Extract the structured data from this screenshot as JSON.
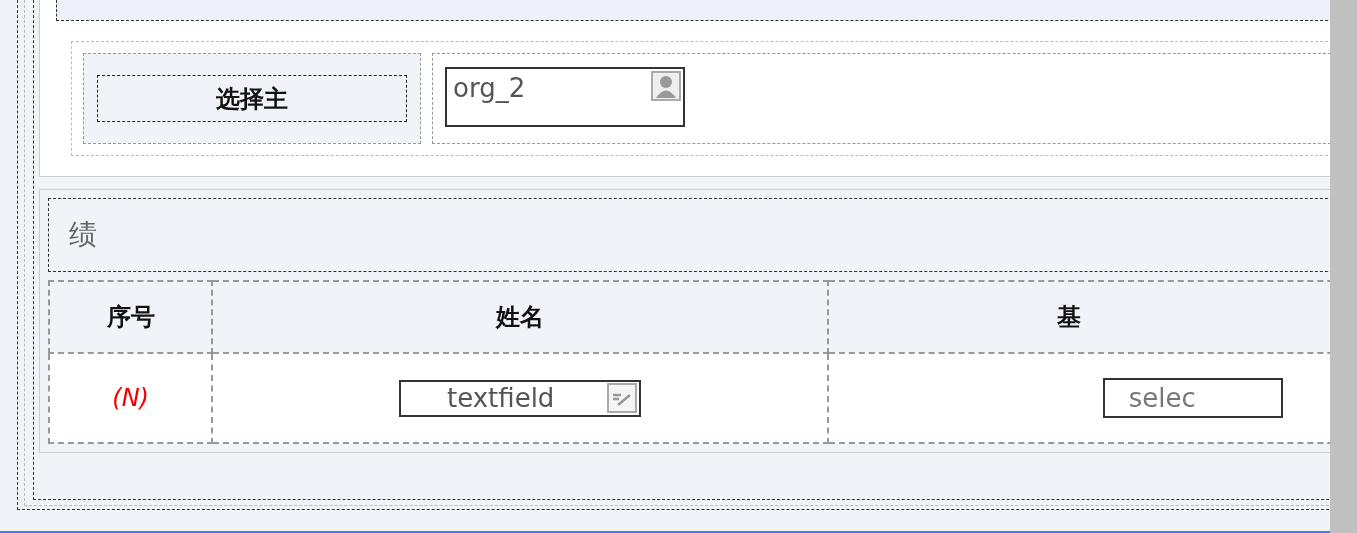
{
  "section_1": {
    "select_button": {
      "label": "选择主"
    },
    "org_field": {
      "value": "org_2"
    }
  },
  "section_2": {
    "title": "绩",
    "table": {
      "columns": [
        "序号",
        "姓名",
        "基"
      ],
      "rows": [
        {
          "index": "(N)",
          "name_field": "textfield",
          "column_3_field": "selec"
        }
      ]
    }
  }
}
